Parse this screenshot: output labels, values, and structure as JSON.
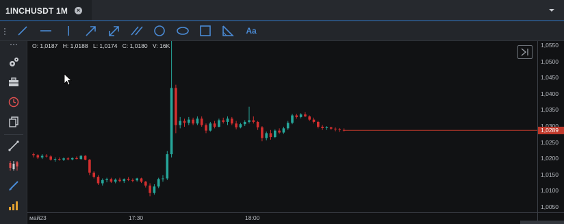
{
  "tab": {
    "title": "1INCHUSDT 1M",
    "close_icon": "close-icon"
  },
  "drawing_tools": [
    {
      "name": "line-tool",
      "icon": "diagonal-line-icon"
    },
    {
      "name": "horizontal-line-tool",
      "icon": "horizontal-line-icon"
    },
    {
      "name": "vertical-line-tool",
      "icon": "vertical-line-icon"
    },
    {
      "name": "arrow-tool",
      "icon": "arrow-icon"
    },
    {
      "name": "double-arrow-tool",
      "icon": "double-arrow-icon"
    },
    {
      "name": "parallel-channel-tool",
      "icon": "parallel-lines-icon"
    },
    {
      "name": "circle-tool",
      "icon": "circle-icon"
    },
    {
      "name": "ellipse-tool",
      "icon": "ellipse-icon"
    },
    {
      "name": "rectangle-tool",
      "icon": "rectangle-icon"
    },
    {
      "name": "triangle-tool",
      "icon": "triangle-icon"
    },
    {
      "name": "text-tool",
      "label": "Aa"
    }
  ],
  "sidebar": [
    {
      "name": "settings",
      "icon": "gears-icon"
    },
    {
      "name": "portfolio",
      "icon": "briefcase-icon"
    },
    {
      "name": "history",
      "icon": "clock-icon"
    },
    {
      "name": "copy",
      "icon": "copy-icon"
    },
    {
      "name": "drawing",
      "icon": "trend-line-icon"
    },
    {
      "name": "chart-type",
      "icon": "candlestick-icon"
    },
    {
      "name": "indicator-brush",
      "icon": "brush-icon"
    },
    {
      "name": "indicators",
      "icon": "bar-chart-icon"
    }
  ],
  "ohlc": {
    "open": "O: 1,0187",
    "high": "H: 1,0188",
    "low": "L: 1,0174",
    "close": "C: 1,0180",
    "volume": "V: 16K"
  },
  "last_price": "1,0289",
  "colors": {
    "up": "#26a69a",
    "down": "#d32f2f",
    "last_price": "#c0392b",
    "accent": "#2d6fb8"
  },
  "chart_data": {
    "type": "candlestick",
    "symbol": "1INCHUSDT",
    "interval": "1M",
    "price_ticks": [
      "1,0550",
      "1,0500",
      "1,0450",
      "1,0400",
      "1,0350",
      "1,0300",
      "1,0250",
      "1,0200",
      "1,0150",
      "1,0100",
      "1,0050"
    ],
    "time_ticks": [
      "май23",
      "17:30",
      "18:00"
    ],
    "ylim": [
      1.0035,
      1.0565
    ],
    "candles": [
      [
        1.0215,
        1.022,
        1.0205,
        1.0212
      ],
      [
        1.0212,
        1.0215,
        1.02,
        1.0205
      ],
      [
        1.0205,
        1.0215,
        1.02,
        1.021
      ],
      [
        1.021,
        1.0215,
        1.0205,
        1.0208
      ],
      [
        1.0208,
        1.0212,
        1.0195,
        1.0198
      ],
      [
        1.0198,
        1.0205,
        1.0192,
        1.02
      ],
      [
        1.02,
        1.0205,
        1.0195,
        1.0198
      ],
      [
        1.0198,
        1.0205,
        1.0194,
        1.0202
      ],
      [
        1.0202,
        1.0206,
        1.0196,
        1.0199
      ],
      [
        1.0199,
        1.0205,
        1.0196,
        1.0203
      ],
      [
        1.0203,
        1.0208,
        1.0199,
        1.02
      ],
      [
        1.02,
        1.0212,
        1.0198,
        1.021
      ],
      [
        1.021,
        1.0212,
        1.0196,
        1.0198
      ],
      [
        1.0198,
        1.02,
        1.015,
        1.0158
      ],
      [
        1.0158,
        1.0162,
        1.014,
        1.0145
      ],
      [
        1.0145,
        1.015,
        1.012,
        1.0125
      ],
      [
        1.0125,
        1.014,
        1.0118,
        1.0135
      ],
      [
        1.0135,
        1.0142,
        1.0128,
        1.0138
      ],
      [
        1.0138,
        1.0142,
        1.0126,
        1.013
      ],
      [
        1.013,
        1.014,
        1.0125,
        1.0136
      ],
      [
        1.0136,
        1.0142,
        1.0128,
        1.0132
      ],
      [
        1.0132,
        1.014,
        1.0126,
        1.0138
      ],
      [
        1.0138,
        1.0144,
        1.0132,
        1.0135
      ],
      [
        1.0135,
        1.014,
        1.0128,
        1.0134
      ],
      [
        1.0134,
        1.0142,
        1.013,
        1.014
      ],
      [
        1.014,
        1.0142,
        1.0126,
        1.013
      ],
      [
        1.013,
        1.0132,
        1.0112,
        1.0118
      ],
      [
        1.0118,
        1.0125,
        1.0085,
        1.0095
      ],
      [
        1.0095,
        1.0122,
        1.009,
        1.0115
      ],
      [
        1.0115,
        1.0142,
        1.011,
        1.0138
      ],
      [
        1.0138,
        1.015,
        1.013,
        1.014
      ],
      [
        1.014,
        1.0225,
        1.0135,
        1.0215
      ],
      [
        1.0215,
        1.057,
        1.0205,
        1.042
      ],
      [
        1.042,
        1.043,
        1.028,
        1.0305
      ],
      [
        1.0305,
        1.033,
        1.0295,
        1.0318
      ],
      [
        1.0318,
        1.0325,
        1.03,
        1.0312
      ],
      [
        1.0312,
        1.033,
        1.0305,
        1.0322
      ],
      [
        1.0322,
        1.0328,
        1.0305,
        1.031
      ],
      [
        1.031,
        1.0332,
        1.0305,
        1.0325
      ],
      [
        1.0325,
        1.0332,
        1.03,
        1.0305
      ],
      [
        1.0305,
        1.031,
        1.028,
        1.0288
      ],
      [
        1.0288,
        1.0315,
        1.0285,
        1.031
      ],
      [
        1.031,
        1.0318,
        1.0295,
        1.03
      ],
      [
        1.03,
        1.0325,
        1.0298,
        1.032
      ],
      [
        1.032,
        1.0328,
        1.031,
        1.0315
      ],
      [
        1.0315,
        1.0332,
        1.0305,
        1.0325
      ],
      [
        1.0325,
        1.033,
        1.0305,
        1.031
      ],
      [
        1.031,
        1.0318,
        1.0292,
        1.0298
      ],
      [
        1.0298,
        1.0312,
        1.0295,
        1.0308
      ],
      [
        1.0308,
        1.032,
        1.0302,
        1.0315
      ],
      [
        1.0315,
        1.0362,
        1.031,
        1.032
      ],
      [
        1.032,
        1.0332,
        1.031,
        1.0315
      ],
      [
        1.0315,
        1.0318,
        1.029,
        1.0298
      ],
      [
        1.0298,
        1.0302,
        1.0255,
        1.0265
      ],
      [
        1.0265,
        1.0285,
        1.0258,
        1.028
      ],
      [
        1.028,
        1.029,
        1.026,
        1.0268
      ],
      [
        1.0268,
        1.0292,
        1.0265,
        1.0288
      ],
      [
        1.0288,
        1.0295,
        1.0278,
        1.0282
      ],
      [
        1.0282,
        1.03,
        1.0278,
        1.0295
      ],
      [
        1.0295,
        1.0318,
        1.029,
        1.0312
      ],
      [
        1.0312,
        1.034,
        1.0308,
        1.0335
      ],
      [
        1.0335,
        1.034,
        1.0325,
        1.033
      ],
      [
        1.033,
        1.0342,
        1.0326,
        1.0338
      ],
      [
        1.0338,
        1.0345,
        1.033,
        1.0332
      ],
      [
        1.0332,
        1.0335,
        1.0318,
        1.0322
      ],
      [
        1.0322,
        1.0328,
        1.031,
        1.0315
      ],
      [
        1.0315,
        1.0318,
        1.0295,
        1.03
      ],
      [
        1.03,
        1.0305,
        1.029,
        1.0296
      ],
      [
        1.0296,
        1.0302,
        1.029,
        1.0298
      ],
      [
        1.0298,
        1.03,
        1.029,
        1.0294
      ],
      [
        1.0294,
        1.0298,
        1.0286,
        1.0292
      ],
      [
        1.0292,
        1.0296,
        1.0284,
        1.029
      ],
      [
        1.029,
        1.0295,
        1.0285,
        1.0289
      ]
    ]
  }
}
